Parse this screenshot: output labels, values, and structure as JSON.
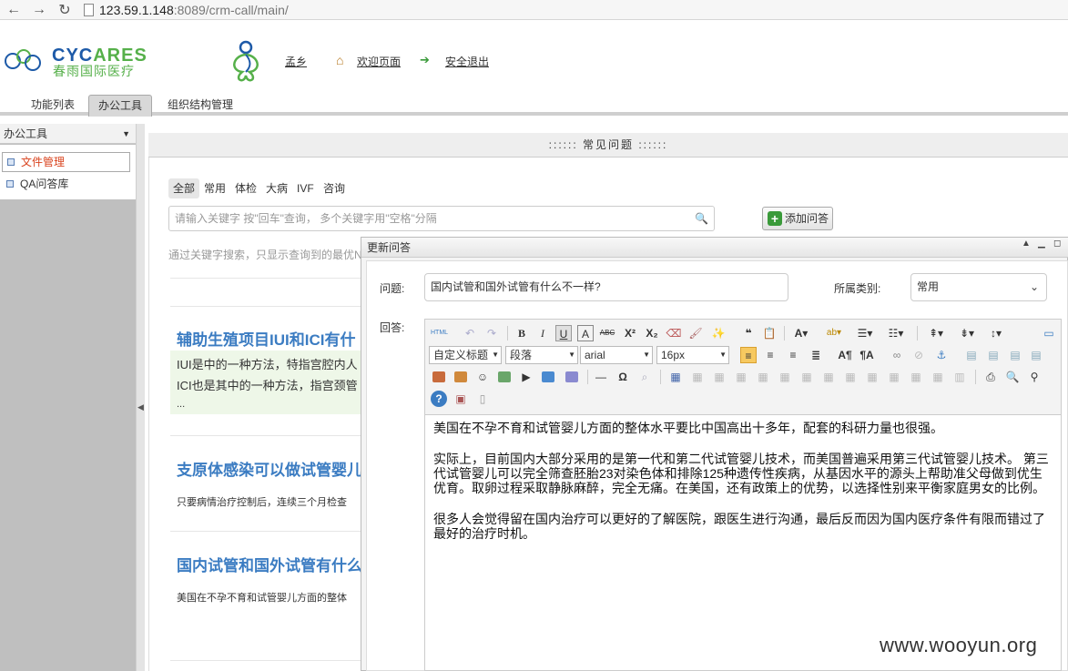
{
  "browser": {
    "host": "123.59.1.148",
    "path": ":8089/crm-call/main/"
  },
  "brand": {
    "en_a": "CYC",
    "en_b": "ARES",
    "cn": "春雨国际医疗"
  },
  "header_links": {
    "user": "孟乡",
    "welcome": "欢迎页面",
    "logout": "安全退出"
  },
  "tabs": [
    "功能列表",
    "办公工具",
    "组织结构管理"
  ],
  "sidebar": {
    "title": "办公工具",
    "items": [
      "文件管理",
      "QA问答库"
    ]
  },
  "main": {
    "title": ":::::: 常见问题 ::::::",
    "categories": [
      "全部",
      "常用",
      "体检",
      "大病",
      "IVF",
      "咨询"
    ],
    "search_placeholder": "请输入关键字 按\"回车\"查询， 多个关键字用\"空格\"分隔",
    "add_button": "添加问答",
    "hint": "通过关键字搜索，只显示查询到的最优N",
    "qa_list": [
      {
        "title": "辅助生殖项目IUI和ICI有什",
        "lines": [
          "IUI是中的一种方法，特指宫腔内人",
          "ICI也是其中的一种方法，指宫颈管",
          "..."
        ]
      },
      {
        "title": "支原体感染可以做试管婴儿",
        "lines": [
          "只要病情治疗控制后，连续三个月检查"
        ]
      },
      {
        "title": "国内试管和国外试管有什么",
        "lines": [
          "美国在不孕不育和试管婴儿方面的整体"
        ]
      }
    ]
  },
  "dialog": {
    "title": "更新问答",
    "question_label": "问题:",
    "question_value": "国内试管和国外试管有什么不一样?",
    "category_label": "所属类别:",
    "category_value": "常用",
    "answer_label": "回答:",
    "toolbar": {
      "heading": "自定义标题",
      "paragraph": "段落",
      "font": "arial",
      "size": "16px"
    },
    "content": [
      "美国在不孕不育和试管婴儿方面的整体水平要比中国高出十多年，配套的科研力量也很强。",
      "实际上，目前国内大部分采用的是第一代和第二代试管婴儿技术，而美国普遍采用第三代试管婴儿技术。 第三代试管婴儿可以完全筛查胚胎23对染色体和排除125种遗传性疾病，从基因水平的源头上帮助准父母做到优生优育。取卵过程采取静脉麻醉，完全无痛。在美国，还有政策上的优势，以选择性别来平衡家庭男女的比例。",
      "很多人会觉得留在国内治疗可以更好的了解医院，跟医生进行沟通，最后反而因为国内医疗条件有限而错过了最好的治疗时机。"
    ]
  },
  "watermark": "www.wooyun.org",
  "colors": {
    "brand_blue": "#1d5aa8",
    "brand_green": "#56b04a",
    "link_blue": "#3b7cc2",
    "active_red": "#d9431e"
  }
}
